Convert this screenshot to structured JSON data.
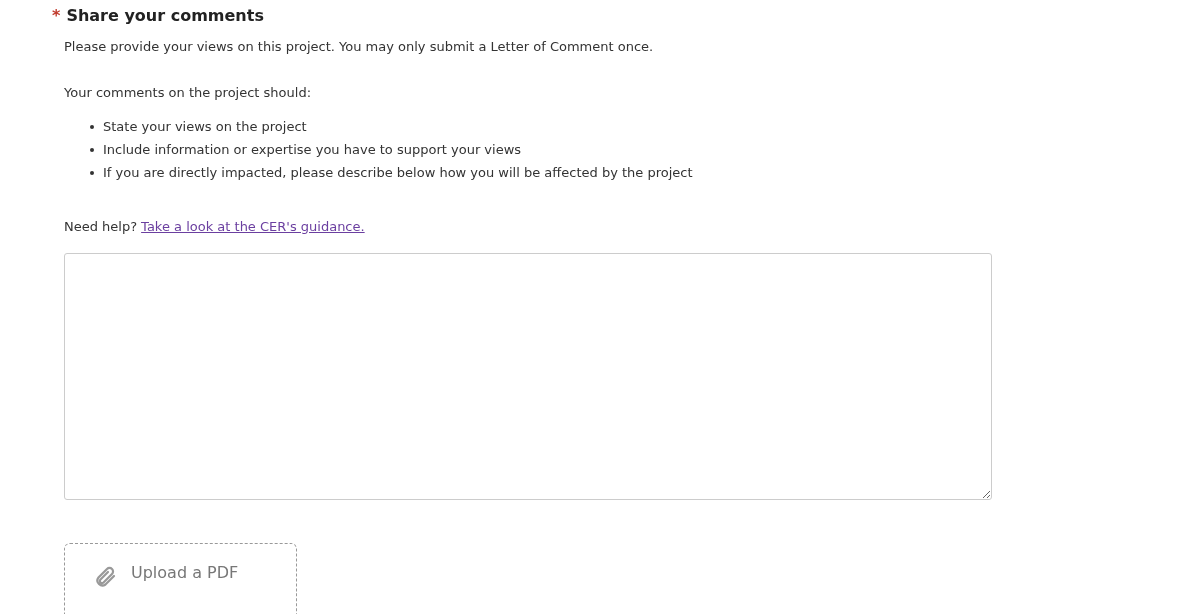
{
  "section": {
    "required_mark": "*",
    "title": "Share your comments",
    "intro": "Please provide your views on this project. You may only submit a Letter of Comment once.",
    "list_heading": "Your comments on the project should:",
    "bullets": [
      "State your views on the project",
      "Include information or expertise you have to support your views",
      "If you are directly impacted, please describe below how you will be affected by the project"
    ],
    "help": {
      "prefix": "Need help?",
      "link": "Take a look at the CER's guidance."
    }
  },
  "upload_button": {
    "label": "Upload a PDF"
  }
}
